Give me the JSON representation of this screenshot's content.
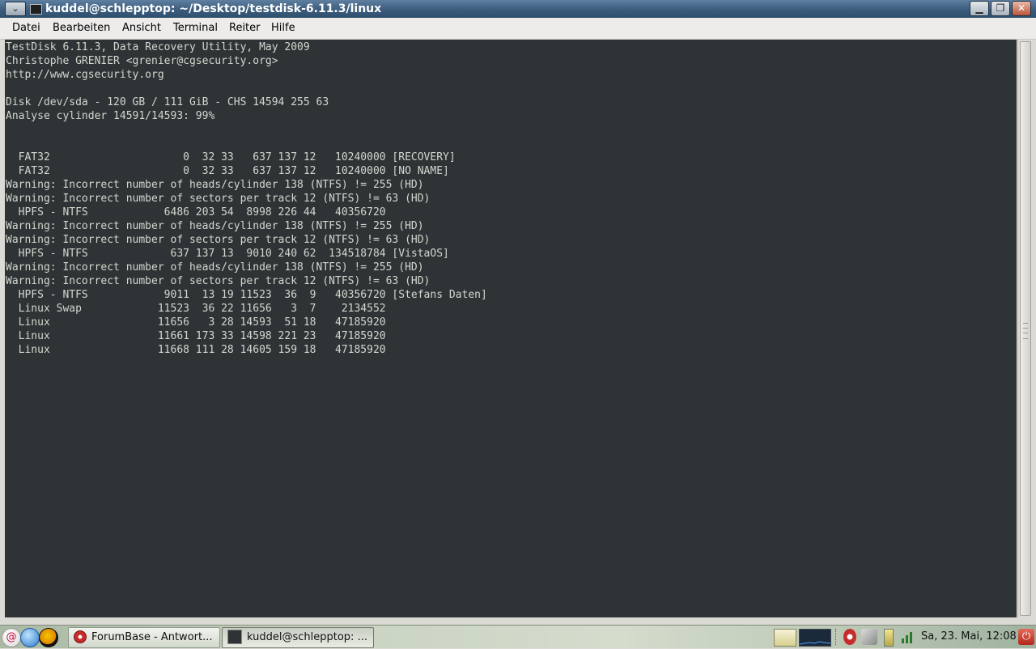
{
  "window": {
    "title": "kuddel@schlepptop: ~/Desktop/testdisk-6.11.3/linux",
    "menu_glyph": "⌄",
    "minimize_glyph": "▁",
    "maximize_glyph": "❐",
    "close_glyph": "✕"
  },
  "menubar": {
    "items": [
      {
        "label": "Datei"
      },
      {
        "label": "Bearbeiten"
      },
      {
        "label": "Ansicht"
      },
      {
        "label": "Terminal"
      },
      {
        "label": "Reiter"
      },
      {
        "label": "Hilfe"
      }
    ]
  },
  "terminal": {
    "background": "#2e3436",
    "foreground": "#d3d7cf",
    "lines": [
      "TestDisk 6.11.3, Data Recovery Utility, May 2009",
      "Christophe GRENIER <grenier@cgsecurity.org>",
      "http://www.cgsecurity.org",
      "",
      "Disk /dev/sda - 120 GB / 111 GiB - CHS 14594 255 63",
      "Analyse cylinder 14591/14593: 99%",
      "",
      "",
      "  FAT32                     0  32 33   637 137 12   10240000 [RECOVERY]",
      "  FAT32                     0  32 33   637 137 12   10240000 [NO NAME]",
      "Warning: Incorrect number of heads/cylinder 138 (NTFS) != 255 (HD)",
      "Warning: Incorrect number of sectors per track 12 (NTFS) != 63 (HD)",
      "  HPFS - NTFS            6486 203 54  8998 226 44   40356720",
      "Warning: Incorrect number of heads/cylinder 138 (NTFS) != 255 (HD)",
      "Warning: Incorrect number of sectors per track 12 (NTFS) != 63 (HD)",
      "  HPFS - NTFS             637 137 13  9010 240 62  134518784 [VistaOS]",
      "Warning: Incorrect number of heads/cylinder 138 (NTFS) != 255 (HD)",
      "Warning: Incorrect number of sectors per track 12 (NTFS) != 63 (HD)",
      "  HPFS - NTFS            9011  13 19 11523  36  9   40356720 [Stefans Daten]",
      "  Linux Swap            11523  36 22 11656   3  7    2134552",
      "  Linux                 11656   3 28 14593  51 18   47185920",
      "  Linux                 11661 173 33 14598 221 23   47185920",
      "  Linux                 11668 111 28 14605 159 18   47185920"
    ]
  },
  "taskbar": {
    "tasks": [
      {
        "label": "ForumBase - Antwort...",
        "icon": "browser-icon"
      },
      {
        "label": "kuddel@schlepptop: ...",
        "icon": "terminal-icon"
      }
    ],
    "clock": "Sa, 23. Mai, 12:08"
  },
  "colors": {
    "titlebar": "#3b5c7c",
    "terminal_bg": "#2e3436",
    "terminal_fg": "#d3d7cf"
  }
}
